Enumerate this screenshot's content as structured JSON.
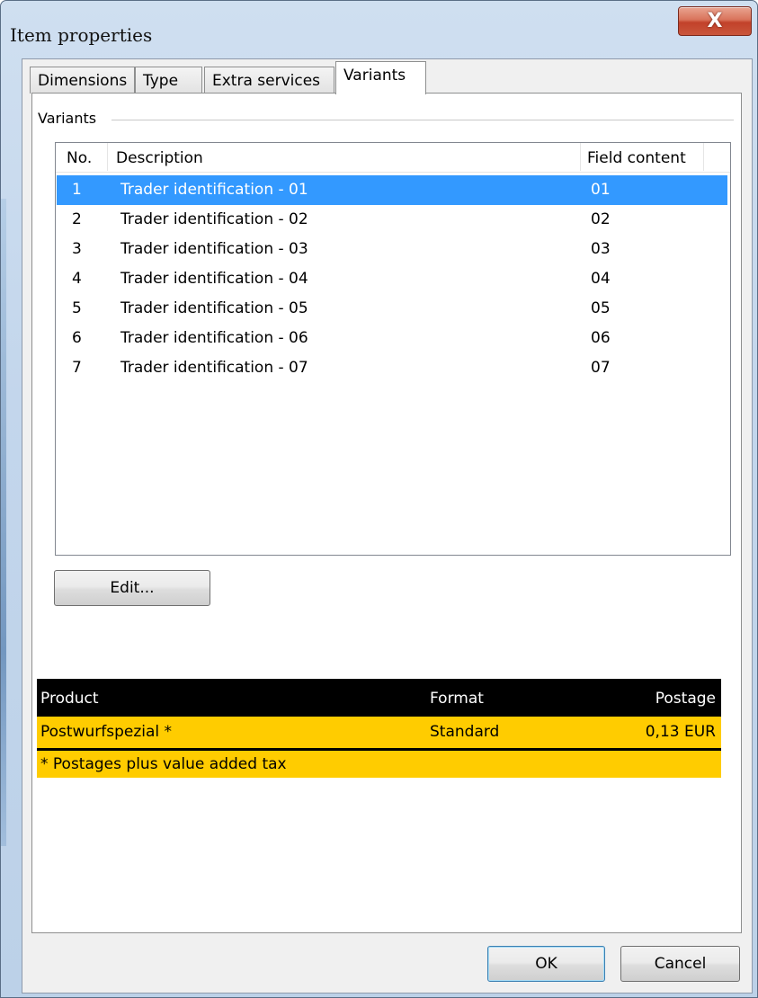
{
  "window": {
    "title": "Item properties",
    "close_label": "X"
  },
  "tabs": [
    {
      "label": "Dimensions"
    },
    {
      "label": "Type"
    },
    {
      "label": "Extra services"
    },
    {
      "label": "Variants",
      "active": true
    }
  ],
  "variants_group": {
    "label": "Variants"
  },
  "variants_list": {
    "columns": [
      "No.",
      "Description",
      "Field content"
    ],
    "selected_index": 0,
    "rows": [
      {
        "no": "1",
        "description": "Trader identification -  01",
        "field": "01"
      },
      {
        "no": "2",
        "description": "Trader identification -  02",
        "field": "02"
      },
      {
        "no": "3",
        "description": "Trader identification -  03",
        "field": "03"
      },
      {
        "no": "4",
        "description": "Trader identification -  04",
        "field": "04"
      },
      {
        "no": "5",
        "description": "Trader identification -  05",
        "field": "05"
      },
      {
        "no": "6",
        "description": "Trader identification -  06",
        "field": "06"
      },
      {
        "no": "7",
        "description": "Trader identification -  07",
        "field": "07"
      }
    ]
  },
  "edit_button": {
    "label": "Edit..."
  },
  "price_table": {
    "headers": {
      "product": "Product",
      "format": "Format",
      "postage": "Postage"
    },
    "row": {
      "product": "Postwurfspezial *",
      "format": "Standard",
      "postage": "0,13 EUR"
    },
    "footnote": "* Postages plus value added tax"
  },
  "footer": {
    "ok_label": "OK",
    "cancel_label": "Cancel"
  },
  "colors": {
    "selection": "#3399ff",
    "price_header_bg": "#000000",
    "price_row_bg": "#ffcc00",
    "close_button": "#c9563c"
  }
}
